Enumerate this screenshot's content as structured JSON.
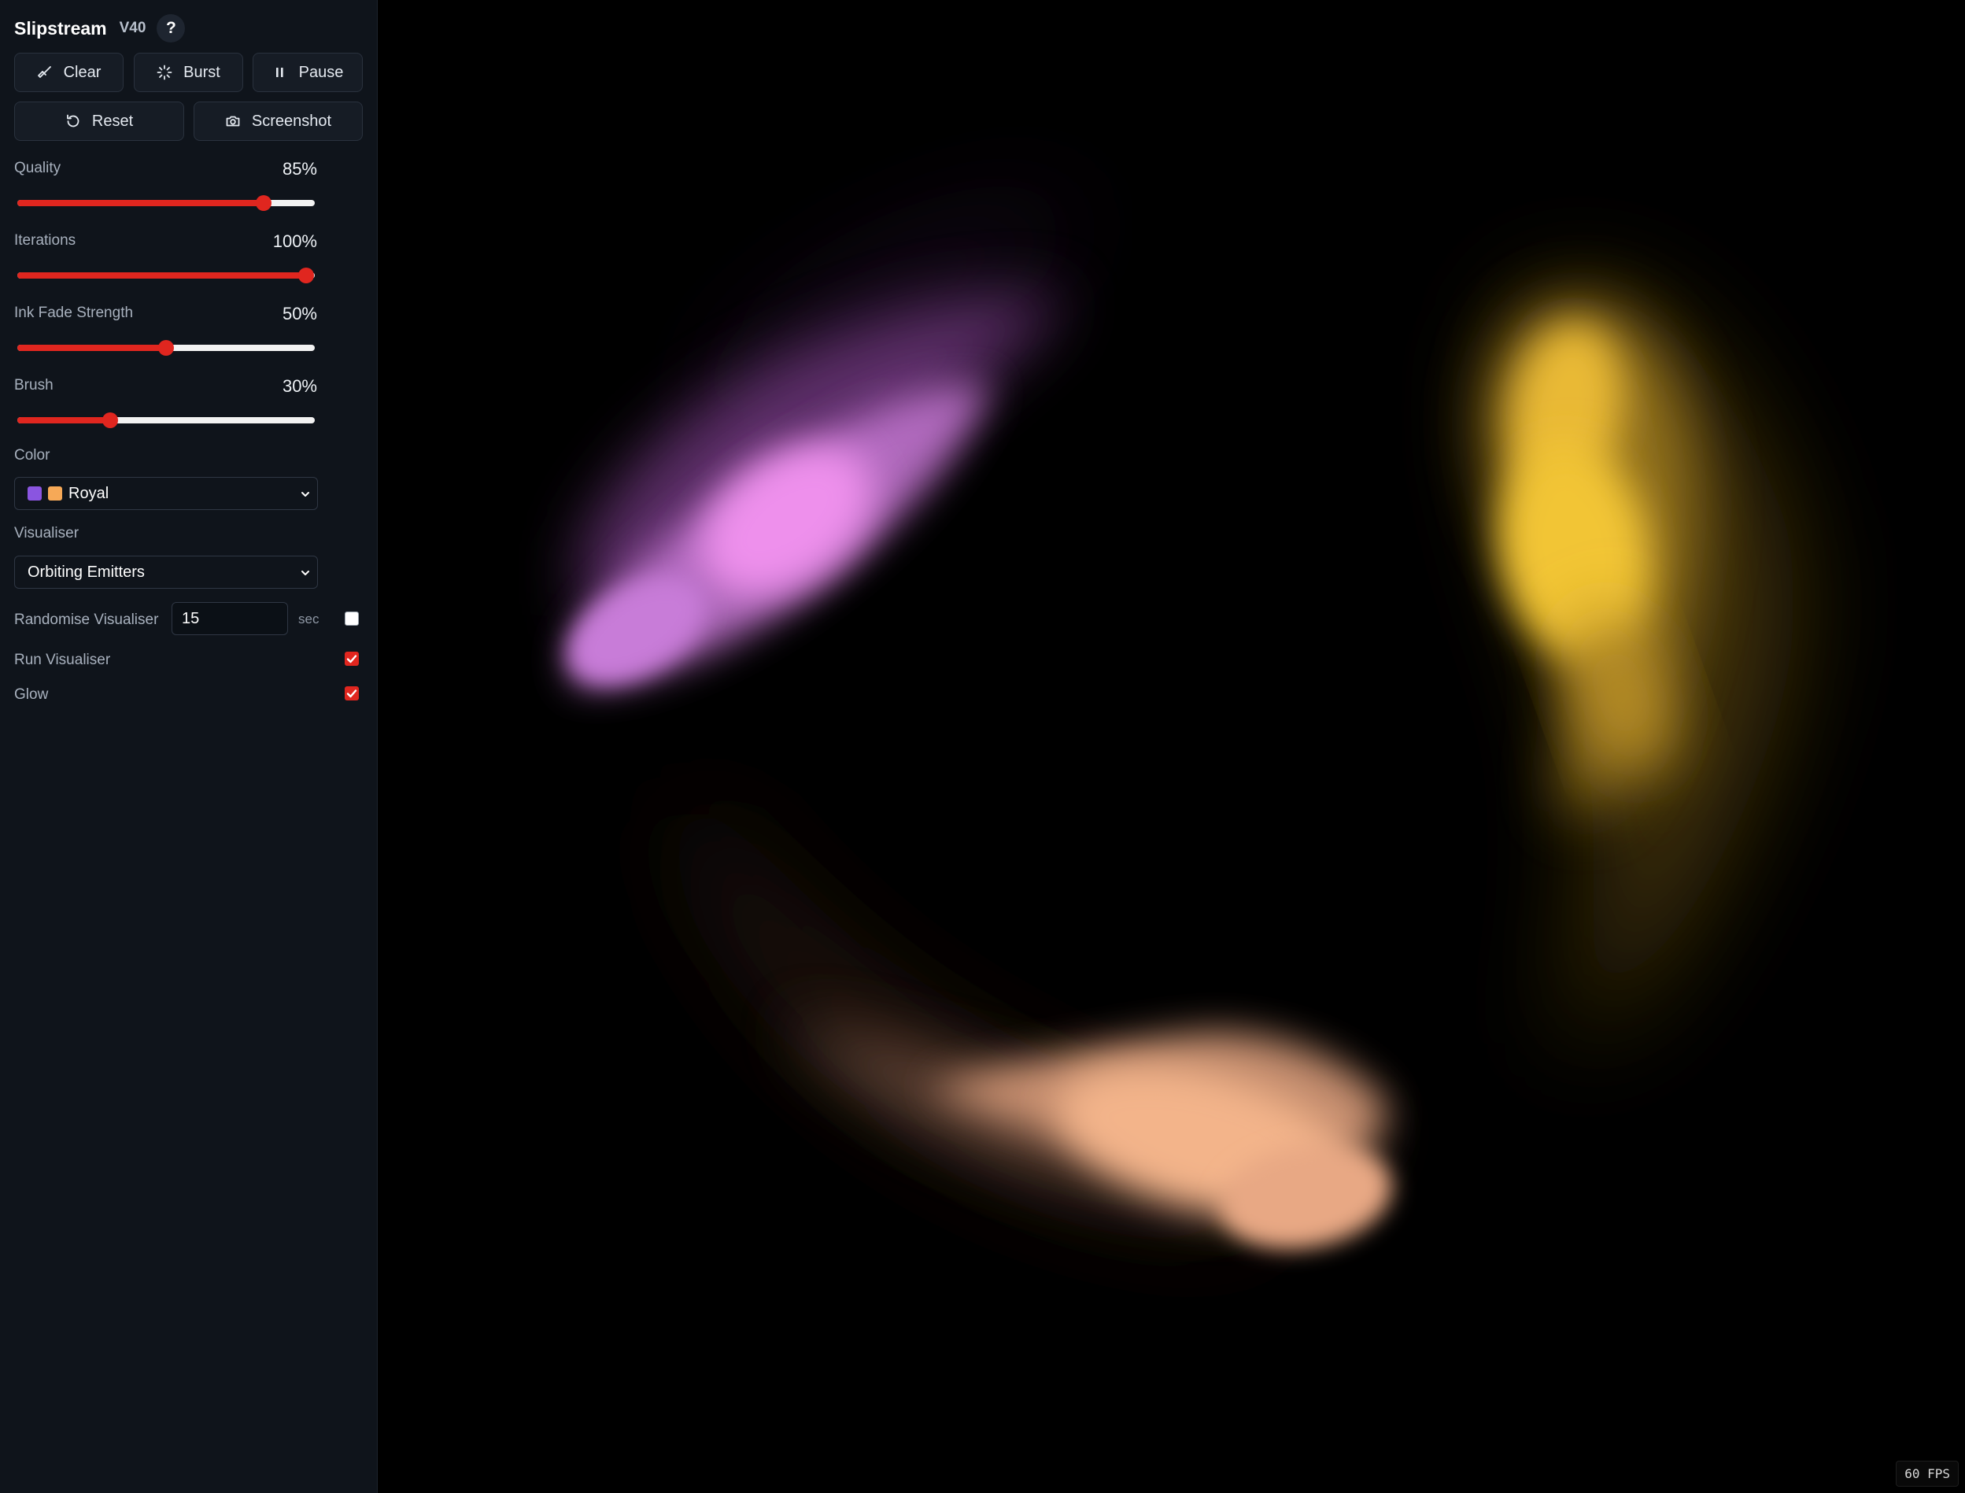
{
  "app": {
    "title": "Slipstream",
    "version": "V40",
    "help_label": "?"
  },
  "toolbar": {
    "clear_label": "Clear",
    "burst_label": "Burst",
    "pause_label": "Pause",
    "reset_label": "Reset",
    "screenshot_label": "Screenshot"
  },
  "sliders": [
    {
      "label": "Quality",
      "value_text": "85%",
      "value": 0.85
    },
    {
      "label": "Iterations",
      "value_text": "100%",
      "value": 1.0
    },
    {
      "label": "Ink Fade Strength",
      "value_text": "50%",
      "value": 0.5
    },
    {
      "label": "Brush",
      "value_text": "30%",
      "value": 0.3
    }
  ],
  "color": {
    "label": "Color",
    "selected": "Royal",
    "swatches": [
      "#8a55e0",
      "#f6a957"
    ]
  },
  "visualiser": {
    "label": "Visualiser",
    "selected": "Orbiting Emitters"
  },
  "randomise": {
    "label": "Randomise Visualiser",
    "value": "15",
    "unit": "sec",
    "checked": false
  },
  "run_visualiser": {
    "label": "Run Visualiser",
    "checked": true
  },
  "glow": {
    "label": "Glow",
    "checked": true
  },
  "status": {
    "fps": "60 FPS"
  },
  "colors": {
    "accent": "#e0261f",
    "ink_magenta": "#ee90ec",
    "ink_yellow": "#f2c534",
    "ink_peach": "#f3b48a"
  }
}
